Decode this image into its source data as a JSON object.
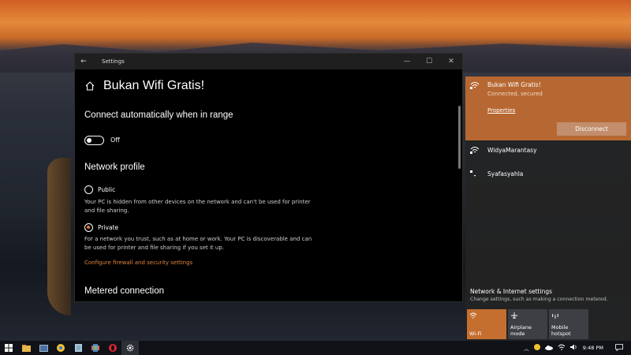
{
  "window": {
    "app_title": "Settings",
    "back_glyph": "←",
    "minimize_glyph": "—",
    "maximize_glyph": "☐",
    "close_glyph": "✕"
  },
  "page": {
    "title": "Bukan Wifi Gratis!",
    "connect_heading": "Connect automatically when in range",
    "toggle_state": "Off",
    "profile_heading": "Network profile",
    "public_label": "Public",
    "public_desc": "Your PC is hidden from other devices on the network and can't be used for printer and file sharing.",
    "private_label": "Private",
    "private_desc": "For a network you trust, such as at home or work. Your PC is discoverable and can be used for printer and file sharing if you set it up.",
    "firewall_link": "Configure firewall and security settings",
    "metered_heading": "Metered connection"
  },
  "flyout": {
    "active": {
      "name": "Bukan Wifi Gratis!",
      "status": "Connected, secured",
      "properties_label": "Properties",
      "disconnect_label": "Disconnect"
    },
    "networks": [
      {
        "name": "WidyaMarantasy"
      },
      {
        "name": "Syafasyahla"
      }
    ],
    "settings_title": "Network & Internet settings",
    "settings_sub": "Change settings, such as making a connection metered.",
    "tiles": [
      {
        "label": "Wi-Fi",
        "icon": "wifi-icon"
      },
      {
        "label": "Airplane mode",
        "icon": "airplane-icon"
      },
      {
        "label": "Mobile hotspot",
        "icon": "hotspot-icon"
      }
    ]
  },
  "taskbar": {
    "time": "9:48 PM",
    "apps": [
      "start-icon",
      "file-explorer-icon",
      "photos-icon",
      "chrome-icon",
      "notepad-icon",
      "paint-icon",
      "opera-icon",
      "settings-icon"
    ]
  },
  "colors": {
    "accent": "#b76832",
    "link": "#e0853f",
    "tile_active": "#c46f2f",
    "tile_inactive": "#3d3f44"
  }
}
